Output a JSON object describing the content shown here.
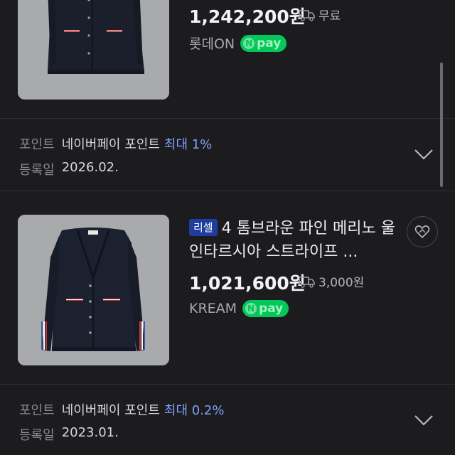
{
  "products": [
    {
      "price": "1,242,200원",
      "shipping": "무료",
      "store": "롯데ON",
      "pay_badge": "pay",
      "points_label": "포인트",
      "points_source": "네이버페이 포인트",
      "points_value": "최대 1%",
      "registered_label": "등록일",
      "registered_date": "2026.02."
    },
    {
      "badge": "리셀",
      "title": "4 톰브라운 파인 메리노 울 인타르시아 스트라이프 ...",
      "price": "1,021,600원",
      "shipping": "3,000원",
      "store": "KREAM",
      "pay_badge": "pay",
      "points_label": "포인트",
      "points_source": "네이버페이 포인트",
      "points_value": "최대 0.2%",
      "registered_label": "등록일",
      "registered_date": "2023.01."
    }
  ],
  "icons": {
    "shipping": "truck-icon",
    "expand": "chevron-down-icon",
    "wishlist": "heart-icon",
    "npay_logo": "n-logo-icon"
  },
  "colors": {
    "background": "#1c1c1e",
    "npay_green": "#03c75a",
    "points_highlight": "#7ea2ff",
    "resell_badge": "#1f3d9e"
  }
}
